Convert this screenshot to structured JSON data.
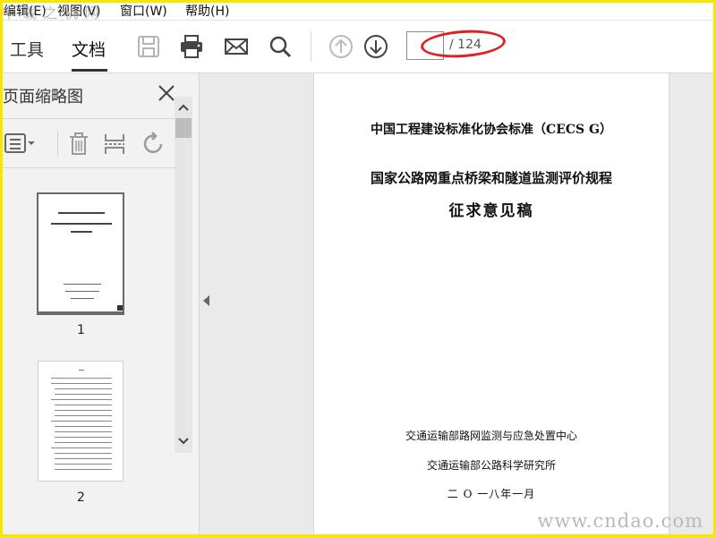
{
  "menu": {
    "items": [
      "编辑(E)",
      "视图(V)",
      "窗口(W)",
      "帮助(H)"
    ]
  },
  "watermark": {
    "top_text": "中 载 之 机 网",
    "bottom_text": "www.cndao.com"
  },
  "toolbar": {
    "tabs": [
      "工具",
      "文档"
    ],
    "active_tab": "文档",
    "current_page": "",
    "page_total": "/ 124"
  },
  "panel": {
    "title": "页面缩略图",
    "thumbnails": [
      {
        "page_number": "1"
      },
      {
        "page_number": "2"
      }
    ]
  },
  "document": {
    "line1": "中国工程建设标准化协会标准（CECS G）",
    "line2": "国家公路网重点桥梁和隧道监测评价规程",
    "line3": "征求意见稿",
    "org1": "交通运输部路网监测与应急处置中心",
    "org2": "交通运输部公路科学研究所",
    "date": "二 O 一八年一月"
  },
  "colors": {
    "frame_border": "#f7e600",
    "annotation_ellipse": "#d22222",
    "panel_bg": "#f2f2f2",
    "doc_bg": "#eaeaea"
  },
  "icons": [
    "save-icon",
    "print-icon",
    "email-icon",
    "search-icon",
    "page-up-icon",
    "page-down-icon",
    "close-icon",
    "options-menu-icon",
    "delete-icon",
    "extract-icon",
    "rotate-icon",
    "scroll-up-icon",
    "scroll-down-icon",
    "collapse-panel-icon"
  ]
}
